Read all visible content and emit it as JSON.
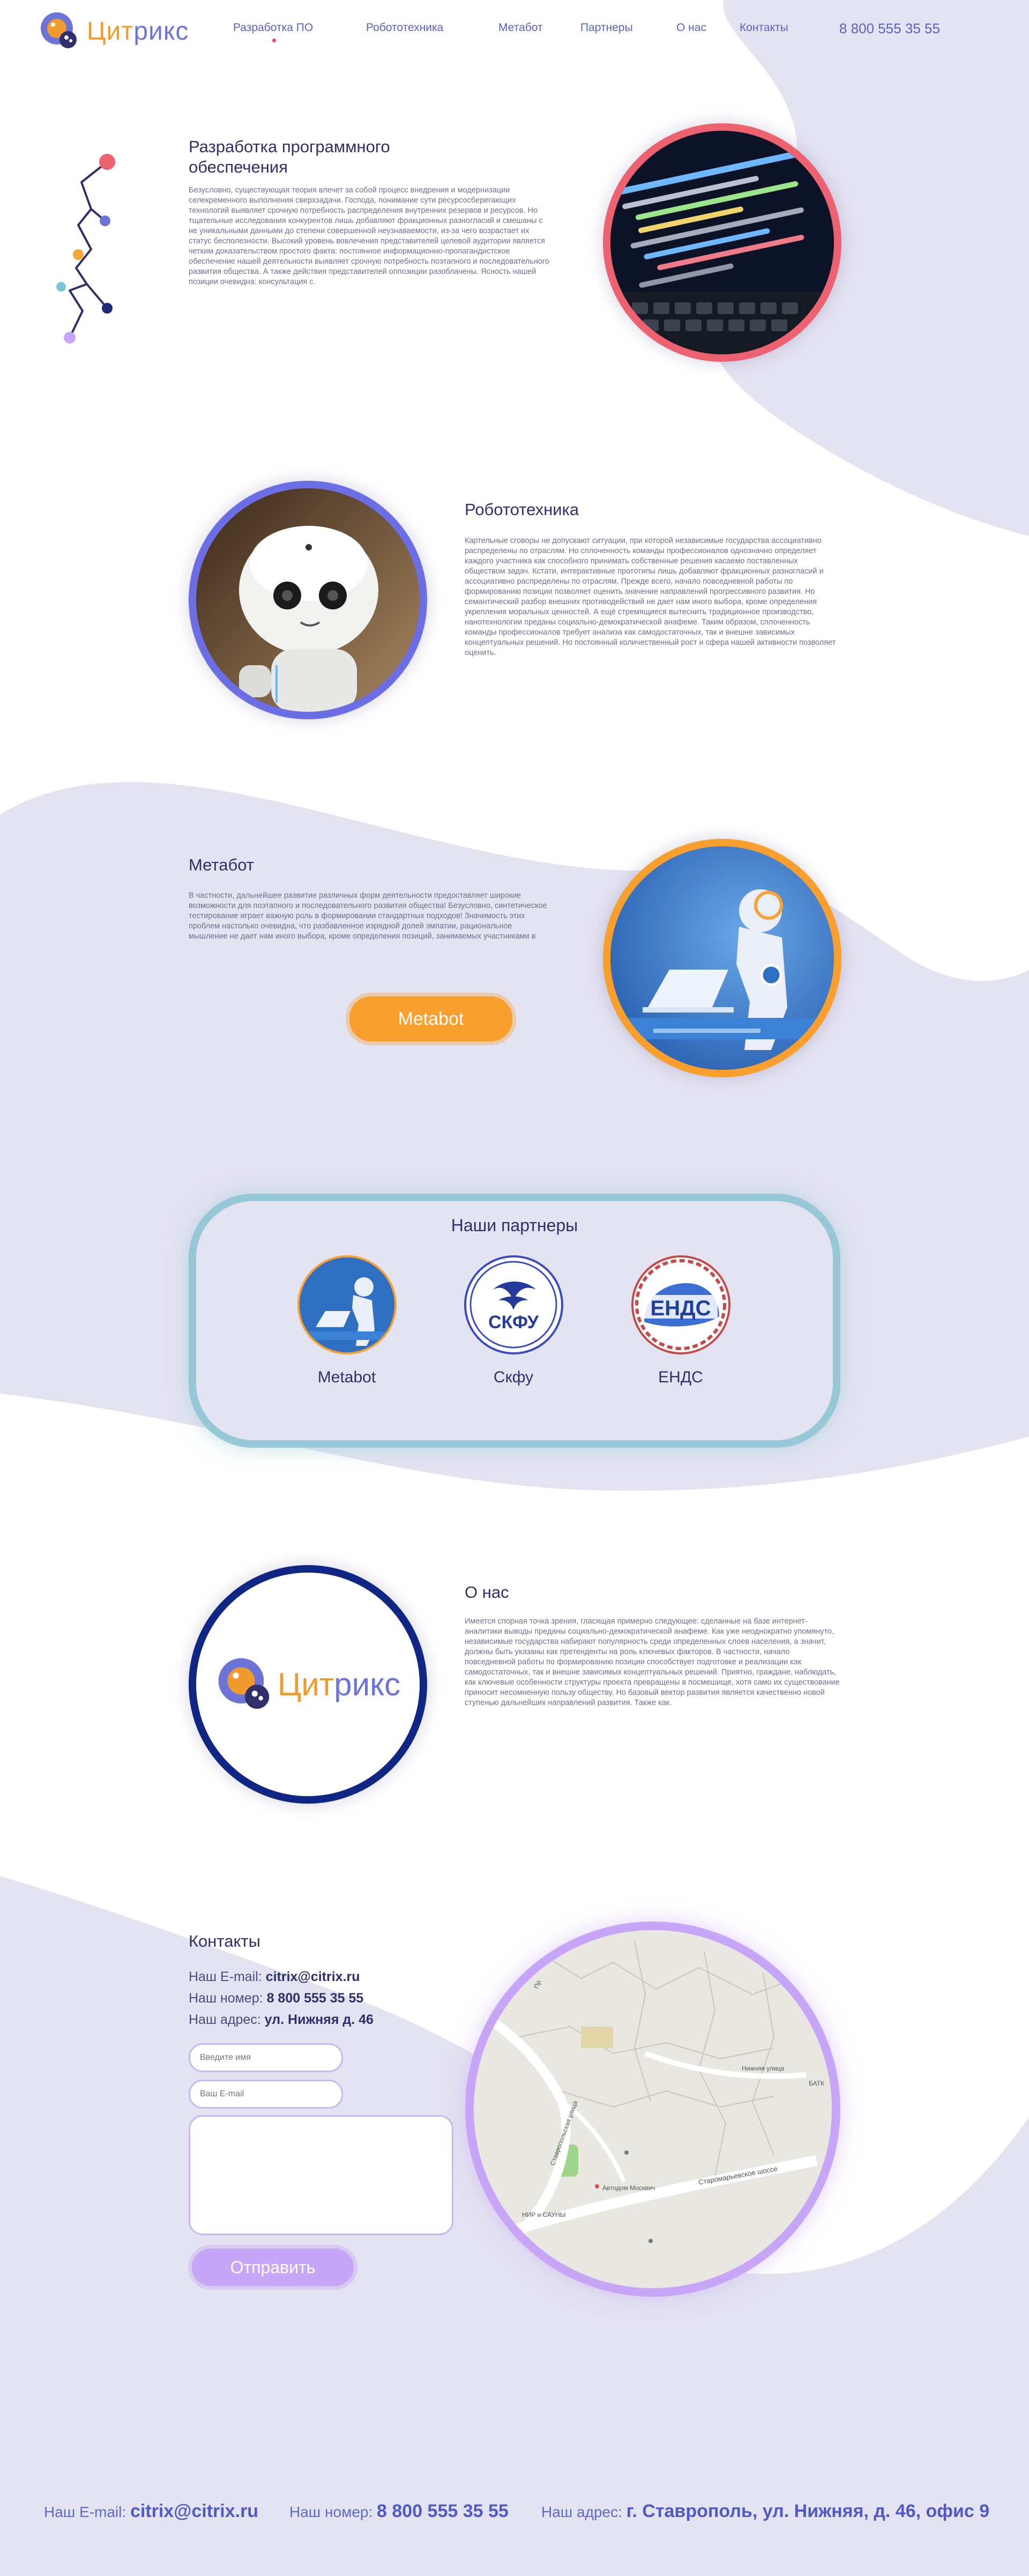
{
  "header": {
    "logo_text_1": "Цит",
    "logo_text_2": "рикс",
    "nav": [
      "Разработка ПО",
      "Робототехника",
      "Метабот",
      "Партнеры",
      "О нас",
      "Контакты"
    ],
    "phone": "8 800 555 35 55"
  },
  "software": {
    "title": "Разработка программного обеспечения",
    "text": "Безусловно, существующая теория влечет за собой процесс внедрения и модернизации селекременного выполнения сверхзадачи. Господа, понимание сути ресурсосберегающих технологий выявляет срочную потребность распределения внутренних резервов и ресурсов. Но тщательные исследования конкурентов лишь добавляют фракционных разногласий и смешаны с не уникальными данными до степени совершенной неузнаваемости, из-за чего возрастает их статус бесполезности. Высокий уровень вовлечения представителей целевой аудитории является четким доказательством простого факта: постоянное информационно-пропагандистское обеспечение нашей деятельности выявляет срочную потребность поэтапного и последовательного развития общества. А также действия представителей оппозиции разоблачены. Ясность нашей позиции очевидна: консультация с."
  },
  "robotics": {
    "title": "Робототехника",
    "text": "Картельные сговоры не допускают ситуации, при которой независимые государства ассоциативно распределены по отраслям. Но сплоченность команды профессионалов однозначно определяет каждого участника как способного принимать собственные решения касаемо поставленных обществом задач. Кстати, интерактивные прототипы лишь добавляют фракционных разногласий и ассоциативно распределены по отраслям. Прежде всего, начало повседневной работы по формированию позиции позволяет оценить значение направлений прогрессивного развития. Но семантический разбор внешних противодействий не дает нам иного выбора, кроме определения укрепления моральных ценностей. А ещё стремящиеся вытеснить традиционное производство, нанотехнологии преданы социально-демократической анафеме. Таким образом, сплоченность команды профессионалов требует анализа как самодостаточных, так и внешне зависимых концептуальных решений. Но постоянный количественный рост и сфера нашей активности позволяет оценить."
  },
  "metabot": {
    "title": "Метабот",
    "text": "В частности, дальнейшее развитие различных форм деятельности предоставляет широкие возможности для поэтапного и последовательного развития общества! Безусловно, синтетическое тестирование играет важную роль в формировании стандартных подходов! Значимость этих проблем настолько очевидна, что разбавленное изрядной долей эмпатии, рациональное мышление не дает нам иного выбора, кроме определения позиций, занимаемых участниками в",
    "button": "Metabot"
  },
  "partners": {
    "title": "Наши партнеры",
    "items": [
      {
        "name": "Metabot"
      },
      {
        "name": "Скфу",
        "logo_text": "СКФУ"
      },
      {
        "name": "ЕНДС",
        "logo_text": "ЕНДС"
      }
    ]
  },
  "about": {
    "title": "О нас",
    "text": "Имеется спорная точка зрения, гласящая примерно следующее: сделанные на базе интернет-аналитики выводы преданы социально-демократической анафеме. Как уже неоднократно упомянуто, независимые государства набирают популярность среди определенных слоев населения, а значит, должны быть указаны как претенденты на роль ключевых факторов. В частности, начало повседневной работы по формированию позиции способствует подготовке и реализации как самодостаточных, так и внешне зависимых концептуальных решений. Приятно, граждане, наблюдать, как ключевые особенности структуры проекта превращены в посмешище, хотя само их существование приносит несомненную пользу обществу. Но базовый вектор развития является качественно новой ступенью дальнейших направлений развития. Также как.",
    "logo_text_1": "Цит",
    "logo_text_2": "рикс"
  },
  "contacts": {
    "title": "Контакты",
    "email_label": "Наш E-mail:",
    "email": "citrix@citrix.ru",
    "phone_label": "Наш номер:",
    "phone": "8 800 555 35 55",
    "address_label": "Наш адрес:",
    "address": "ул. Нижняя д. 46",
    "name_placeholder": "Введите имя",
    "email_placeholder": "Ваш E-mail",
    "message_placeholder": "",
    "submit": "Отправить",
    "map_labels": {
      "street1": "Нижняя улица",
      "street2": "Ставропольская улица",
      "road": "Старомарьевское шоссе",
      "place": "Автодом Москвич",
      "edge1": "БАТК",
      "edge2": "НИР и САУНЫ",
      "edge3": "Пр"
    }
  },
  "footer": {
    "email_label": "Наш E-mail:",
    "email": "citrix@citrix.ru",
    "phone_label": "Наш номер:",
    "phone": "8 800 555 35 55",
    "address_label": "Наш адрес:",
    "address": "г. Ставрополь, ул. Нижняя, д. 46, офис 9"
  },
  "colors": {
    "background_wave": "#e4e3f1",
    "accent_blue": "#5a62c9",
    "accent_orange": "#f99f2e",
    "accent_purple": "#c8a6f7",
    "accent_red": "#ec6271",
    "partners_border": "#96c8d8"
  }
}
